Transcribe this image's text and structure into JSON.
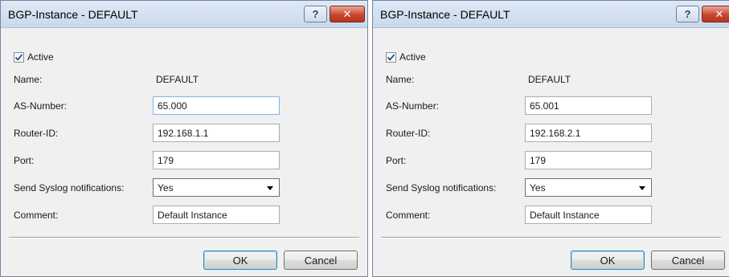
{
  "dialogs": [
    {
      "title": "BGP-Instance - DEFAULT",
      "help_label": "?",
      "close_label": "✕",
      "active_label": "Active",
      "active_checked": true,
      "name_label": "Name:",
      "name_value": "DEFAULT",
      "as_number_label": "AS-Number:",
      "as_number_value": "65.000",
      "router_id_label": "Router-ID:",
      "router_id_value": "192.168.1.1",
      "port_label": "Port:",
      "port_value": "179",
      "syslog_label": "Send Syslog notifications:",
      "syslog_value": "Yes",
      "comment_label": "Comment:",
      "comment_value": "Default Instance",
      "ok_label": "OK",
      "cancel_label": "Cancel"
    },
    {
      "title": "BGP-Instance - DEFAULT",
      "help_label": "?",
      "close_label": "✕",
      "active_label": "Active",
      "active_checked": true,
      "name_label": "Name:",
      "name_value": "DEFAULT",
      "as_number_label": "AS-Number:",
      "as_number_value": "65.001",
      "router_id_label": "Router-ID:",
      "router_id_value": "192.168.2.1",
      "port_label": "Port:",
      "port_value": "179",
      "syslog_label": "Send Syslog notifications:",
      "syslog_value": "Yes",
      "comment_label": "Comment:",
      "comment_value": "Default Instance",
      "ok_label": "OK",
      "cancel_label": "Cancel"
    }
  ],
  "icons": {
    "checkbox_mark": "checkmark-icon",
    "dropdown_arrow": "chevron-down-icon"
  },
  "colors": {
    "title_bar": "#c9d9ec",
    "close_button": "#c7472f",
    "dialog_bg": "#f0f0f0",
    "focus_border": "#7eb4ea"
  }
}
